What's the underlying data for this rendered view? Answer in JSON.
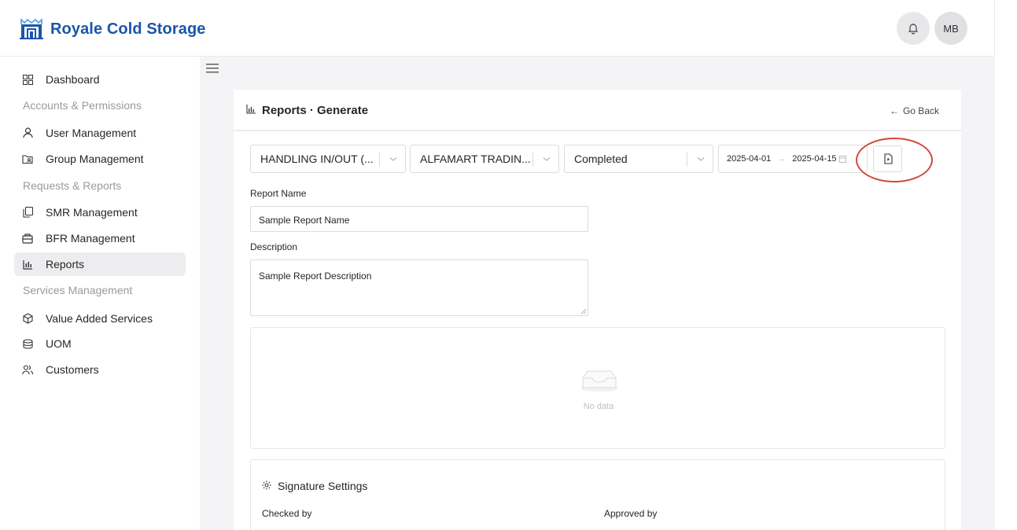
{
  "brand": {
    "name": "Royale Cold Storage",
    "accent": "#1a56a8"
  },
  "header": {
    "bell_icon": "bell-icon",
    "avatar_initials": "MB"
  },
  "sidebar": {
    "items": [
      {
        "label": "Dashboard",
        "icon": "dashboard-icon"
      },
      {
        "group": "Accounts & Permissions"
      },
      {
        "label": "User Management",
        "icon": "user-icon"
      },
      {
        "label": "Group Management",
        "icon": "folder-user-icon"
      },
      {
        "group": "Requests & Reports"
      },
      {
        "label": "SMR Management",
        "icon": "copy-icon"
      },
      {
        "label": "BFR Management",
        "icon": "box-icon"
      },
      {
        "label": "Reports",
        "icon": "bar-chart-icon",
        "active": true
      },
      {
        "group": "Services Management"
      },
      {
        "label": "Value Added Services",
        "icon": "cube-icon"
      },
      {
        "label": "UOM",
        "icon": "database-icon"
      },
      {
        "label": "Customers",
        "icon": "users-icon"
      }
    ]
  },
  "page": {
    "title": "Reports · Generate",
    "go_back": "Go Back"
  },
  "filters": {
    "report_type": "HANDLING IN/OUT (...",
    "customer": "ALFAMART TRADIN...",
    "status": "Completed",
    "date_from": "2025-04-01",
    "date_to": "2025-04-15",
    "range_separator": "→"
  },
  "form": {
    "report_name_label": "Report Name",
    "report_name_value": "Sample Report Name",
    "description_label": "Description",
    "description_value": "Sample Report Description"
  },
  "table": {
    "empty_text": "No data"
  },
  "signature": {
    "title": "Signature Settings",
    "checked_by_label": "Checked by",
    "approved_by_label": "Approved by"
  },
  "annotation": {
    "highlight_color": "#d24a3a"
  }
}
